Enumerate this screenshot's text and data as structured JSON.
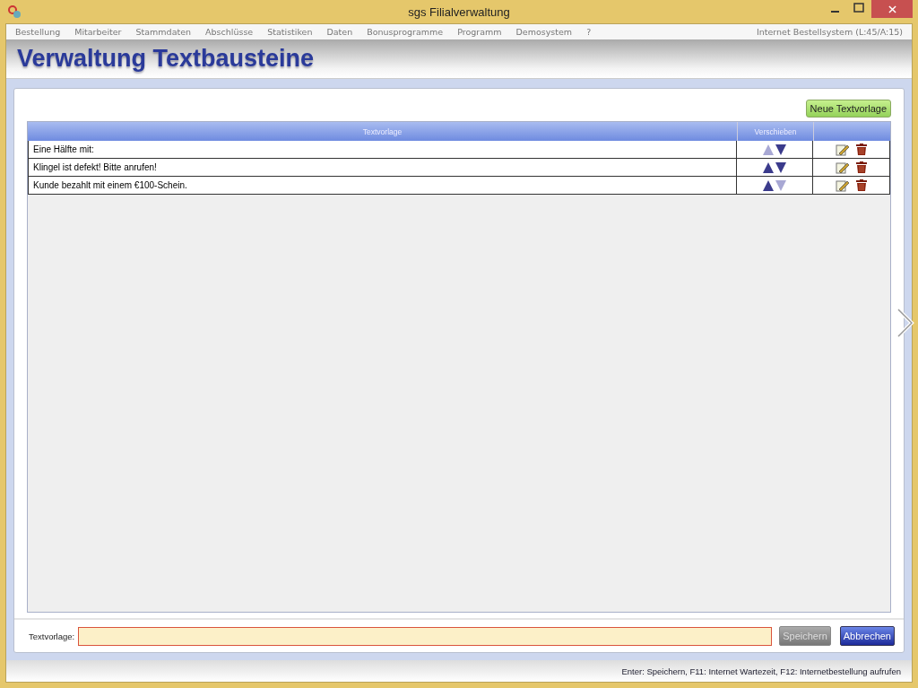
{
  "window": {
    "title": "sgs Filialverwaltung"
  },
  "menu": {
    "items": [
      "Bestellung",
      "Mitarbeiter",
      "Stammdaten",
      "Abschlüsse",
      "Statistiken",
      "Daten",
      "Bonusprogramme",
      "Programm",
      "Demosystem",
      "?"
    ],
    "info": "Internet Bestellsystem (L:45/A:15)"
  },
  "page_title": "Verwaltung Textbausteine",
  "new_button": "Neue Textvorlage",
  "table": {
    "columns": [
      "Textvorlage",
      "Verschieben"
    ],
    "rows": [
      {
        "text": "Eine Hälfte mit:",
        "up_disabled": true,
        "down_disabled": false
      },
      {
        "text": "Klingel ist defekt! Bitte anrufen!",
        "up_disabled": false,
        "down_disabled": false
      },
      {
        "text": "Kunde bezahlt mit einem €100-Schein.",
        "up_disabled": false,
        "down_disabled": true
      }
    ]
  },
  "editor": {
    "label": "Textvorlage:",
    "save_button": {
      "label": "Speichern",
      "disabled": true
    },
    "cancel_button": {
      "label": "Abbrechen",
      "disabled": false
    }
  },
  "status_bar": "Enter: Speichern, F11: Internet Wartezeit, F12: Internetbestellung aufrufen"
}
